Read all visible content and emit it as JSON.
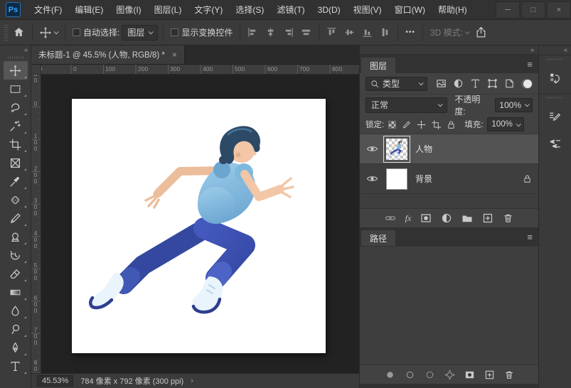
{
  "icons": {
    "app_logo": "Ps",
    "minimize": "─",
    "maximize": "□",
    "close": "×",
    "tab_close": "×",
    "collapse_right": "»",
    "expand_left": "«",
    "panel_menu": "≡",
    "ellipsis": "•••",
    "status_chevron": "›"
  },
  "titlebar": {
    "menus": [
      "文件(F)",
      "编辑(E)",
      "图像(I)",
      "图层(L)",
      "文字(Y)",
      "选择(S)",
      "滤镜(T)",
      "3D(D)",
      "视图(V)",
      "窗口(W)",
      "帮助(H)"
    ]
  },
  "options_bar": {
    "auto_select_label": "自动选择:",
    "auto_select_value": "图层",
    "show_transform_label": "显示变换控件",
    "mode_3d_label": "3D 模式:"
  },
  "document": {
    "tab_title": "未标题-1 @ 45.5% (人物, RGB/8) *"
  },
  "rulers": {
    "h": [
      "00",
      "0",
      "100",
      "200",
      "300",
      "400",
      "500",
      "600",
      "700",
      "800"
    ],
    "v": [
      "00",
      "0",
      "100",
      "200",
      "300",
      "400",
      "500",
      "600",
      "700",
      "800"
    ]
  },
  "toolbar": {
    "tools": [
      "move",
      "rectangular-marquee",
      "lasso",
      "magic-wand",
      "crop",
      "frame",
      "eyedropper",
      "spot-healing",
      "brush",
      "clone-stamp",
      "history-brush",
      "eraser",
      "gradient",
      "blur",
      "dodge",
      "pen",
      "type"
    ]
  },
  "layers_panel": {
    "tab_label": "图层",
    "filter_value": "类型",
    "blend_mode": "正常",
    "opacity_label": "不透明度:",
    "opacity_value": "100%",
    "lock_label": "锁定:",
    "fill_label": "填充:",
    "fill_value": "100%",
    "layers": [
      {
        "name": "人物",
        "selected": true,
        "locked": false
      },
      {
        "name": "背景",
        "selected": false,
        "locked": true
      }
    ]
  },
  "paths_panel": {
    "tab_label": "路径"
  },
  "status_bar": {
    "zoom": "45.53%",
    "doc_info": "784 像素 x 792 像素 (300 ppi)"
  },
  "colors": {
    "accent_blue": "#3ba4ff",
    "hair": "#2c4a66",
    "skin": "#f2c6a6",
    "shirt": "#85bfe3",
    "pants": "#3d53b2",
    "shoes": "#e9f4fc",
    "sole": "#2e3f8d"
  }
}
